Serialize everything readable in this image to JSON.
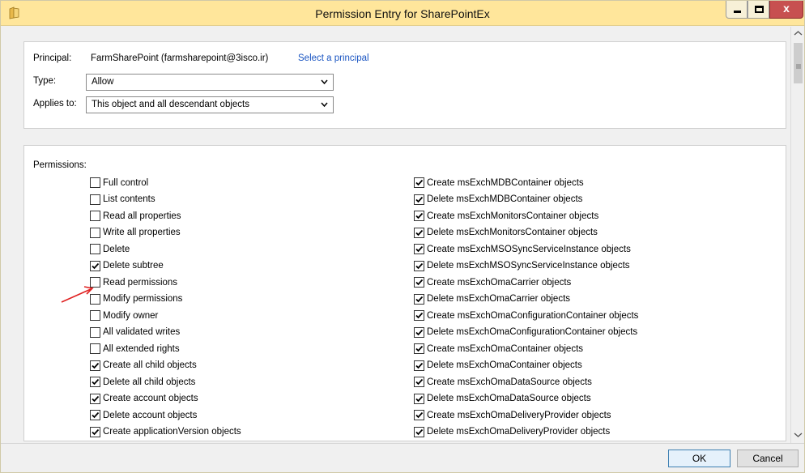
{
  "window": {
    "title": "Permission Entry for SharePointEx",
    "controls": {
      "minimize": "_",
      "close": "x"
    }
  },
  "principal": {
    "label": "Principal:",
    "value": "FarmSharePoint (farmsharepoint@3isco.ir)",
    "select_link": "Select a principal"
  },
  "type": {
    "label": "Type:",
    "value": "Allow"
  },
  "applies_to": {
    "label": "Applies to:",
    "value": "This object and all descendant objects"
  },
  "permissions": {
    "label": "Permissions:",
    "left": [
      {
        "label": "Full control",
        "checked": false
      },
      {
        "label": "List contents",
        "checked": false
      },
      {
        "label": "Read all properties",
        "checked": false
      },
      {
        "label": "Write all properties",
        "checked": false
      },
      {
        "label": "Delete",
        "checked": false
      },
      {
        "label": "Delete subtree",
        "checked": true
      },
      {
        "label": "Read permissions",
        "checked": false
      },
      {
        "label": "Modify permissions",
        "checked": false
      },
      {
        "label": "Modify owner",
        "checked": false
      },
      {
        "label": "All validated writes",
        "checked": false
      },
      {
        "label": "All extended rights",
        "checked": false
      },
      {
        "label": "Create all child objects",
        "checked": true
      },
      {
        "label": "Delete all child objects",
        "checked": true
      },
      {
        "label": "Create account objects",
        "checked": true
      },
      {
        "label": "Delete account objects",
        "checked": true
      },
      {
        "label": "Create applicationVersion objects",
        "checked": true
      }
    ],
    "right": [
      {
        "label": "Create msExchMDBContainer objects",
        "checked": true
      },
      {
        "label": "Delete msExchMDBContainer objects",
        "checked": true
      },
      {
        "label": "Create msExchMonitorsContainer objects",
        "checked": true
      },
      {
        "label": "Delete msExchMonitorsContainer objects",
        "checked": true
      },
      {
        "label": "Create msExchMSOSyncServiceInstance objects",
        "checked": true
      },
      {
        "label": "Delete msExchMSOSyncServiceInstance objects",
        "checked": true
      },
      {
        "label": "Create msExchOmaCarrier objects",
        "checked": true
      },
      {
        "label": "Delete msExchOmaCarrier objects",
        "checked": true
      },
      {
        "label": "Create msExchOmaConfigurationContainer objects",
        "checked": true
      },
      {
        "label": "Delete msExchOmaConfigurationContainer objects",
        "checked": true
      },
      {
        "label": "Create msExchOmaContainer objects",
        "checked": true
      },
      {
        "label": "Delete msExchOmaContainer objects",
        "checked": true
      },
      {
        "label": "Create msExchOmaDataSource objects",
        "checked": true
      },
      {
        "label": "Delete msExchOmaDataSource objects",
        "checked": true
      },
      {
        "label": "Create msExchOmaDeliveryProvider objects",
        "checked": true
      },
      {
        "label": "Delete msExchOmaDeliveryProvider objects",
        "checked": true
      }
    ]
  },
  "footer": {
    "ok": "OK",
    "cancel": "Cancel"
  },
  "colors": {
    "titlebar": "#ffe69b",
    "close_button": "#c75050",
    "link": "#1a55c2",
    "annotation_arrow": "#e02020"
  },
  "icons": {
    "title": "folder-icon",
    "dropdown": "chevron-down-icon",
    "checkbox": "checkmark-icon",
    "annotation": "red-arrow-icon"
  }
}
